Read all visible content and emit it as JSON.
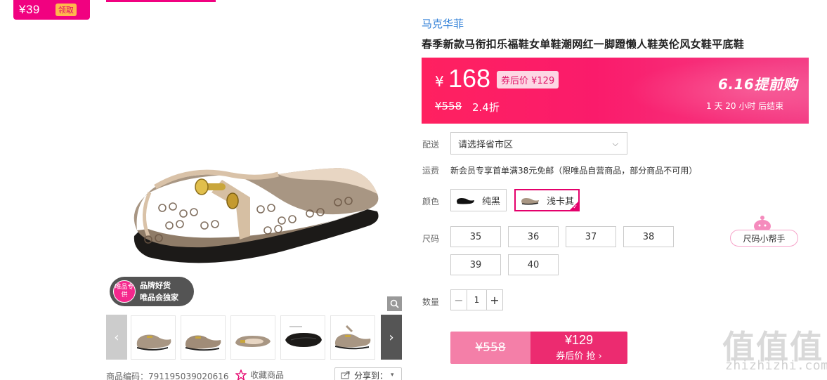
{
  "coupon_badge": {
    "amount": "¥39",
    "claim_label": "领取"
  },
  "gallery": {
    "brand_tag_circle": "唯品专供",
    "brand_tag_line1": "品牌好货",
    "brand_tag_line2": "唯品会独家",
    "sku_label": "商品编码：791195039020616",
    "favorite_label": "收藏商品",
    "share_label": "分享到：",
    "thumbnails": [
      "thumb-1",
      "thumb-2",
      "thumb-3",
      "thumb-4",
      "thumb-5",
      "thumb-6"
    ]
  },
  "product": {
    "brand": "马克华菲",
    "title": "春季新款马衔扣乐福鞋女单鞋潮网红一脚蹬懒人鞋英伦风女鞋平底鞋"
  },
  "price": {
    "currency": "¥",
    "value": "168",
    "coupon_price": "券后价 ¥129",
    "original": "¥558",
    "discount": "2.4折",
    "promo_title": "6.16提前购",
    "countdown": "1 天 20 小时 后结束"
  },
  "delivery": {
    "label": "配送",
    "placeholder": "请选择省市区"
  },
  "shipping": {
    "label": "运费",
    "text": "新会员专享首单满38元免邮（限唯品自营商品，部分商品不可用）"
  },
  "color": {
    "label": "颜色",
    "options": [
      {
        "name": "纯黑",
        "selected": false
      },
      {
        "name": "浅卡其",
        "selected": true
      }
    ]
  },
  "size": {
    "label": "尺码",
    "options": [
      "35",
      "36",
      "37",
      "38",
      "39",
      "40"
    ],
    "helper_label": "尺码小帮手"
  },
  "quantity": {
    "label": "数量",
    "value": "1",
    "minus": "−",
    "plus": "+"
  },
  "buy": {
    "original": "¥558",
    "price": "¥129",
    "sub_label": "券后价 抢 ›"
  },
  "watermark": {
    "logo": "值值值",
    "url": "zhizhizhi.com"
  },
  "colors": {
    "accent": "#f10180",
    "banner_start": "#ff2160",
    "banner_end": "#f43f86",
    "buy_button": "#ec2b70",
    "buy_left": "#f47fa8",
    "brand_link": "#2f7fd7"
  }
}
